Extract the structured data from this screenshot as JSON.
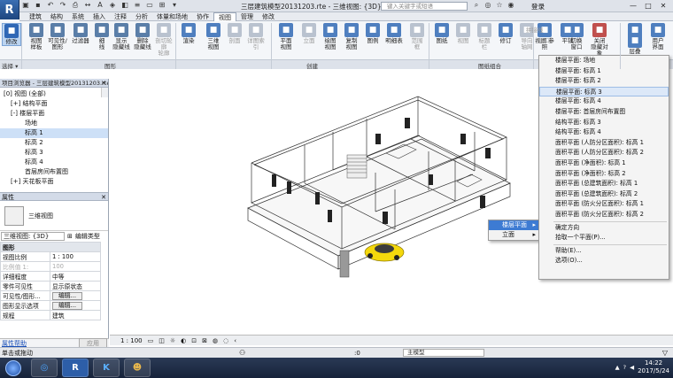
{
  "app": {
    "logo": "R",
    "title": "三层建筑模型20131203.rte - 三维视图: {3D}",
    "search_placeholder": "键入关键字或短语",
    "login": "登录"
  },
  "tabs": [
    "建筑",
    "结构",
    "系统",
    "插入",
    "注释",
    "分析",
    "体量和场地",
    "协作",
    "视图",
    "管理",
    "修改"
  ],
  "active_tab": "视图",
  "ribbon": {
    "tools": [
      {
        "label": "修改",
        "icon": "cursor-icon",
        "color": "#2f67b5",
        "state": "selected"
      },
      {
        "label": "视图\n样板",
        "icon": "template-icon",
        "color": "#5a7ea8"
      },
      {
        "label": "可见性/\n图形",
        "icon": "visibility-icon",
        "color": "#5a7ea8"
      },
      {
        "label": "过滤器",
        "icon": "filter-icon",
        "color": "#5a7ea8"
      },
      {
        "label": "细\n线",
        "icon": "thin-lines-icon",
        "color": "#5a7ea8"
      },
      {
        "label": "显示\n隐藏线",
        "icon": "show-hidden-icon",
        "color": "#5a7ea8"
      },
      {
        "label": "删除\n隐藏线",
        "icon": "remove-hidden-icon",
        "color": "#5a7ea8"
      },
      {
        "label": "剖切轮廓\n轮廓",
        "icon": "cut-profile-icon",
        "color": "#b9c2cf",
        "state": "disabled"
      },
      {
        "label": "渲染",
        "icon": "render-icon",
        "color": "#4f7fbf"
      },
      {
        "label": "三维\n视图",
        "icon": "3d-view-icon",
        "color": "#4f7fbf"
      },
      {
        "label": "剖面",
        "icon": "section-icon",
        "color": "#b9c2cf",
        "state": "disabled"
      },
      {
        "label": "详图索引",
        "icon": "callout-icon",
        "color": "#b9c2cf",
        "state": "disabled"
      },
      {
        "label": "平面\n视图",
        "icon": "plan-view-icon",
        "color": "#4f7fbf"
      },
      {
        "label": "立面",
        "icon": "elevation-icon",
        "color": "#b9c2cf",
        "state": "disabled"
      },
      {
        "label": "绘图\n视图",
        "icon": "drafting-icon",
        "color": "#4f7fbf"
      },
      {
        "label": "复制\n视图",
        "icon": "duplicate-icon",
        "color": "#4f7fbf"
      },
      {
        "label": "图例",
        "icon": "legend-icon",
        "color": "#4f7fbf"
      },
      {
        "label": "明细表",
        "icon": "schedule-icon",
        "color": "#4f7fbf"
      },
      {
        "label": "范围\n框",
        "icon": "scope-box-icon",
        "color": "#b9c2cf",
        "state": "disabled"
      },
      {
        "label": "图纸",
        "icon": "sheet-icon",
        "color": "#4f7fbf"
      },
      {
        "label": "视图",
        "icon": "view-icon",
        "color": "#b9c2cf",
        "state": "disabled"
      },
      {
        "label": "标题\n栏",
        "icon": "title-block-icon",
        "color": "#b9c2cf",
        "state": "disabled"
      },
      {
        "label": "修订",
        "icon": "revision-icon",
        "color": "#4f7fbf"
      },
      {
        "label": "导向\n轴网",
        "icon": "guide-grid-icon",
        "color": "#b9c2cf",
        "state": "disabled"
      },
      {
        "label": "视图 参照",
        "icon": "view-reference-icon",
        "color": "#4f7fbf"
      },
      {
        "label": "切换\n窗口",
        "icon": "switch-window-icon",
        "color": "#4f7fbf"
      },
      {
        "label": "关闭\n隐藏对象",
        "icon": "close-hidden-icon",
        "color": "#c0504d"
      },
      {
        "label": "复制",
        "icon": "replicate-icon",
        "color": "#4f7fbf"
      },
      {
        "label": "层叠",
        "icon": "cascade-icon",
        "color": "#4f7fbf"
      },
      {
        "label": "平铺",
        "icon": "tile-icon",
        "color": "#4f7fbf"
      },
      {
        "label": "用户\n界面",
        "icon": "user-interface-icon",
        "color": "#4f7fbf"
      }
    ],
    "small_labels": [
      "拼接线",
      "视口"
    ],
    "panels": [
      "选择 ▾",
      "图形",
      "创建",
      "图纸组合",
      "窗口"
    ]
  },
  "browser": {
    "title": "项目浏览器 - 三层建筑模型20131203.rte",
    "items": [
      {
        "label": "[0] 视图 (全部)",
        "indent": 0
      },
      {
        "label": "结构平面",
        "indent": 1,
        "toggle": "+"
      },
      {
        "label": "楼层平面",
        "indent": 1,
        "toggle": "-"
      },
      {
        "label": "场地",
        "indent": 3
      },
      {
        "label": "标高 1",
        "indent": 3,
        "selected": true
      },
      {
        "label": "标高 2",
        "indent": 3
      },
      {
        "label": "标高 3",
        "indent": 3
      },
      {
        "label": "标高 4",
        "indent": 3
      },
      {
        "label": "首层房间布置图",
        "indent": 3
      },
      {
        "label": "天花板平面",
        "indent": 1,
        "toggle": "+"
      }
    ]
  },
  "properties": {
    "title": "属性",
    "type_name": "三维视图",
    "view_selector": "三维视图: {3D}",
    "edit_type": "编辑类型",
    "rows": [
      {
        "k": "图形",
        "v": "",
        "group": true
      },
      {
        "k": "视图比例",
        "v": "1 : 100"
      },
      {
        "k": "比例值 1:",
        "v": "100",
        "gray": true
      },
      {
        "k": "详细程度",
        "v": "中等"
      },
      {
        "k": "零件可见性",
        "v": "显示原状态"
      },
      {
        "k": "可见性/图形...",
        "v": "编辑...",
        "button": true
      },
      {
        "k": "图形显示选项",
        "v": "编辑...",
        "button": true
      },
      {
        "k": "规程",
        "v": "建筑"
      }
    ],
    "help_link": "属性帮助",
    "apply": "应用"
  },
  "context_menu_1": {
    "items": [
      {
        "label": "楼层平面",
        "arrow": "▸",
        "highlighted": true
      },
      {
        "label": "立面",
        "arrow": "▸"
      }
    ]
  },
  "context_menu_2": {
    "items": [
      "楼层平面: 场地",
      "楼层平面: 标高 1",
      "楼层平面: 标高 2",
      "楼层平面: 标高 3",
      "楼层平面: 标高 4",
      "楼层平面: 首层房间布置图",
      "结构平面: 标高 3",
      "结构平面: 标高 4",
      "面积平面 (人防分区面积): 标高 1",
      "面积平面 (人防分区面积): 标高 2",
      "面积平面 (净面积): 标高 1",
      "面积平面 (净面积): 标高 2",
      "面积平面 (总建筑面积): 标高 1",
      "面积平面 (总建筑面积): 标高 2",
      "面积平面 (防火分区面积): 标高 1",
      "面积平面 (防火分区面积): 标高 2"
    ],
    "highlighted_index": 3,
    "extra": [
      "确定方向",
      "拾取一个平面(P)...",
      "帮助(E)...",
      "选项(O)..."
    ]
  },
  "view_control": {
    "scale": "1 : 100"
  },
  "status": {
    "text": "单击或拖动",
    "model": "主模型",
    "zero": ":0"
  },
  "taskbar": {
    "apps": [
      "start",
      "browser",
      "revit",
      "kuaizip",
      "game"
    ],
    "time": "14:22",
    "date": "2017/5/24"
  }
}
